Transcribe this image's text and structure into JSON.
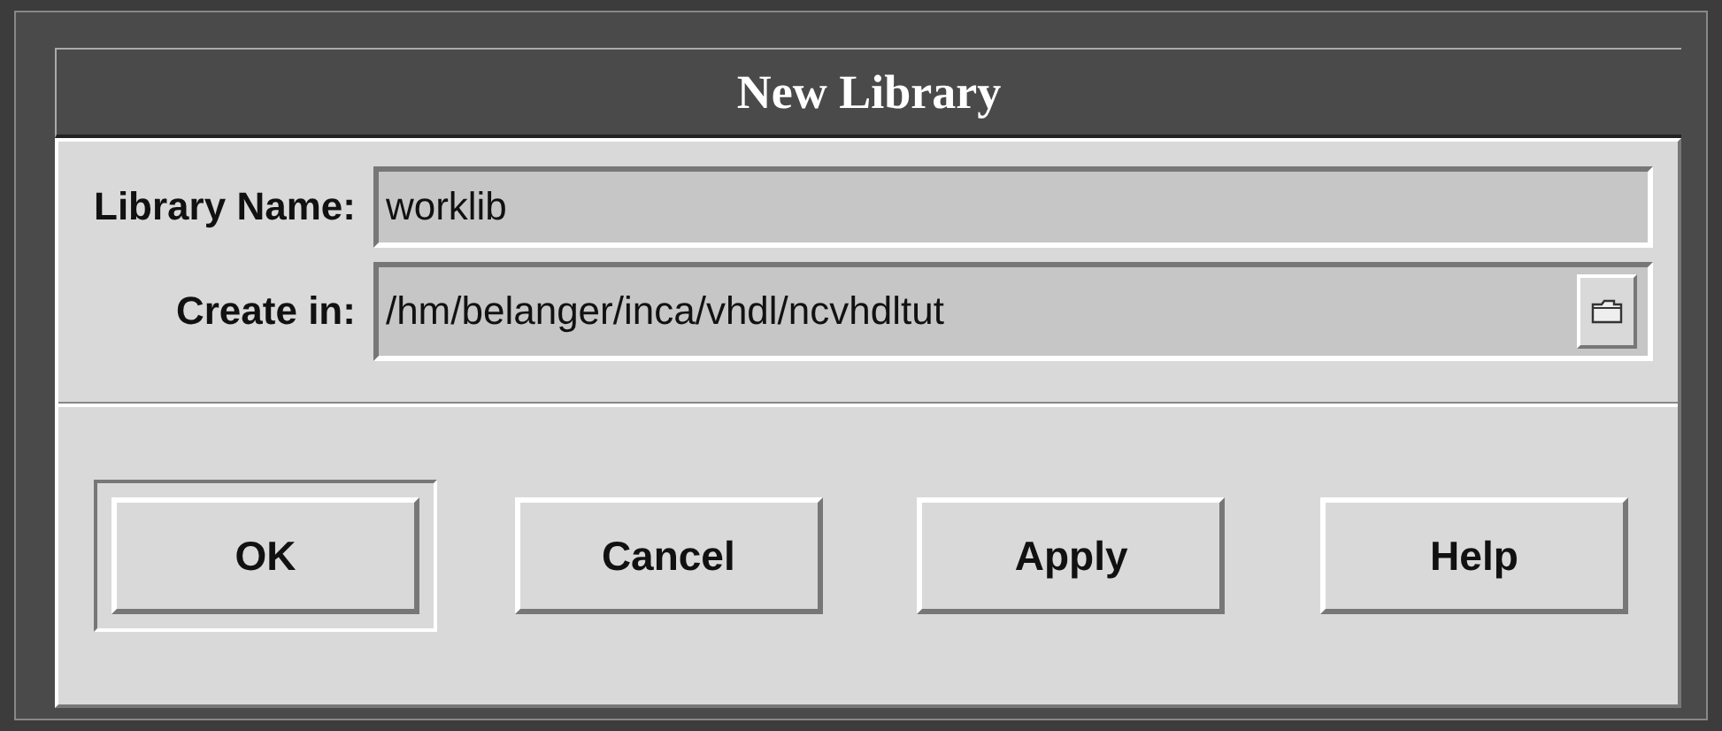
{
  "window": {
    "title": "New Library"
  },
  "fields": [
    {
      "label": "Library Name:",
      "value": "worklib",
      "kind": "text"
    },
    {
      "label": "Create in:",
      "value": "/hm/belanger/inca/vhdl/ncvhdltut",
      "kind": "path"
    }
  ],
  "buttons": [
    {
      "label": "OK",
      "default": true
    },
    {
      "label": "Cancel",
      "default": false
    },
    {
      "label": "Apply",
      "default": false
    },
    {
      "label": "Help",
      "default": false
    }
  ]
}
